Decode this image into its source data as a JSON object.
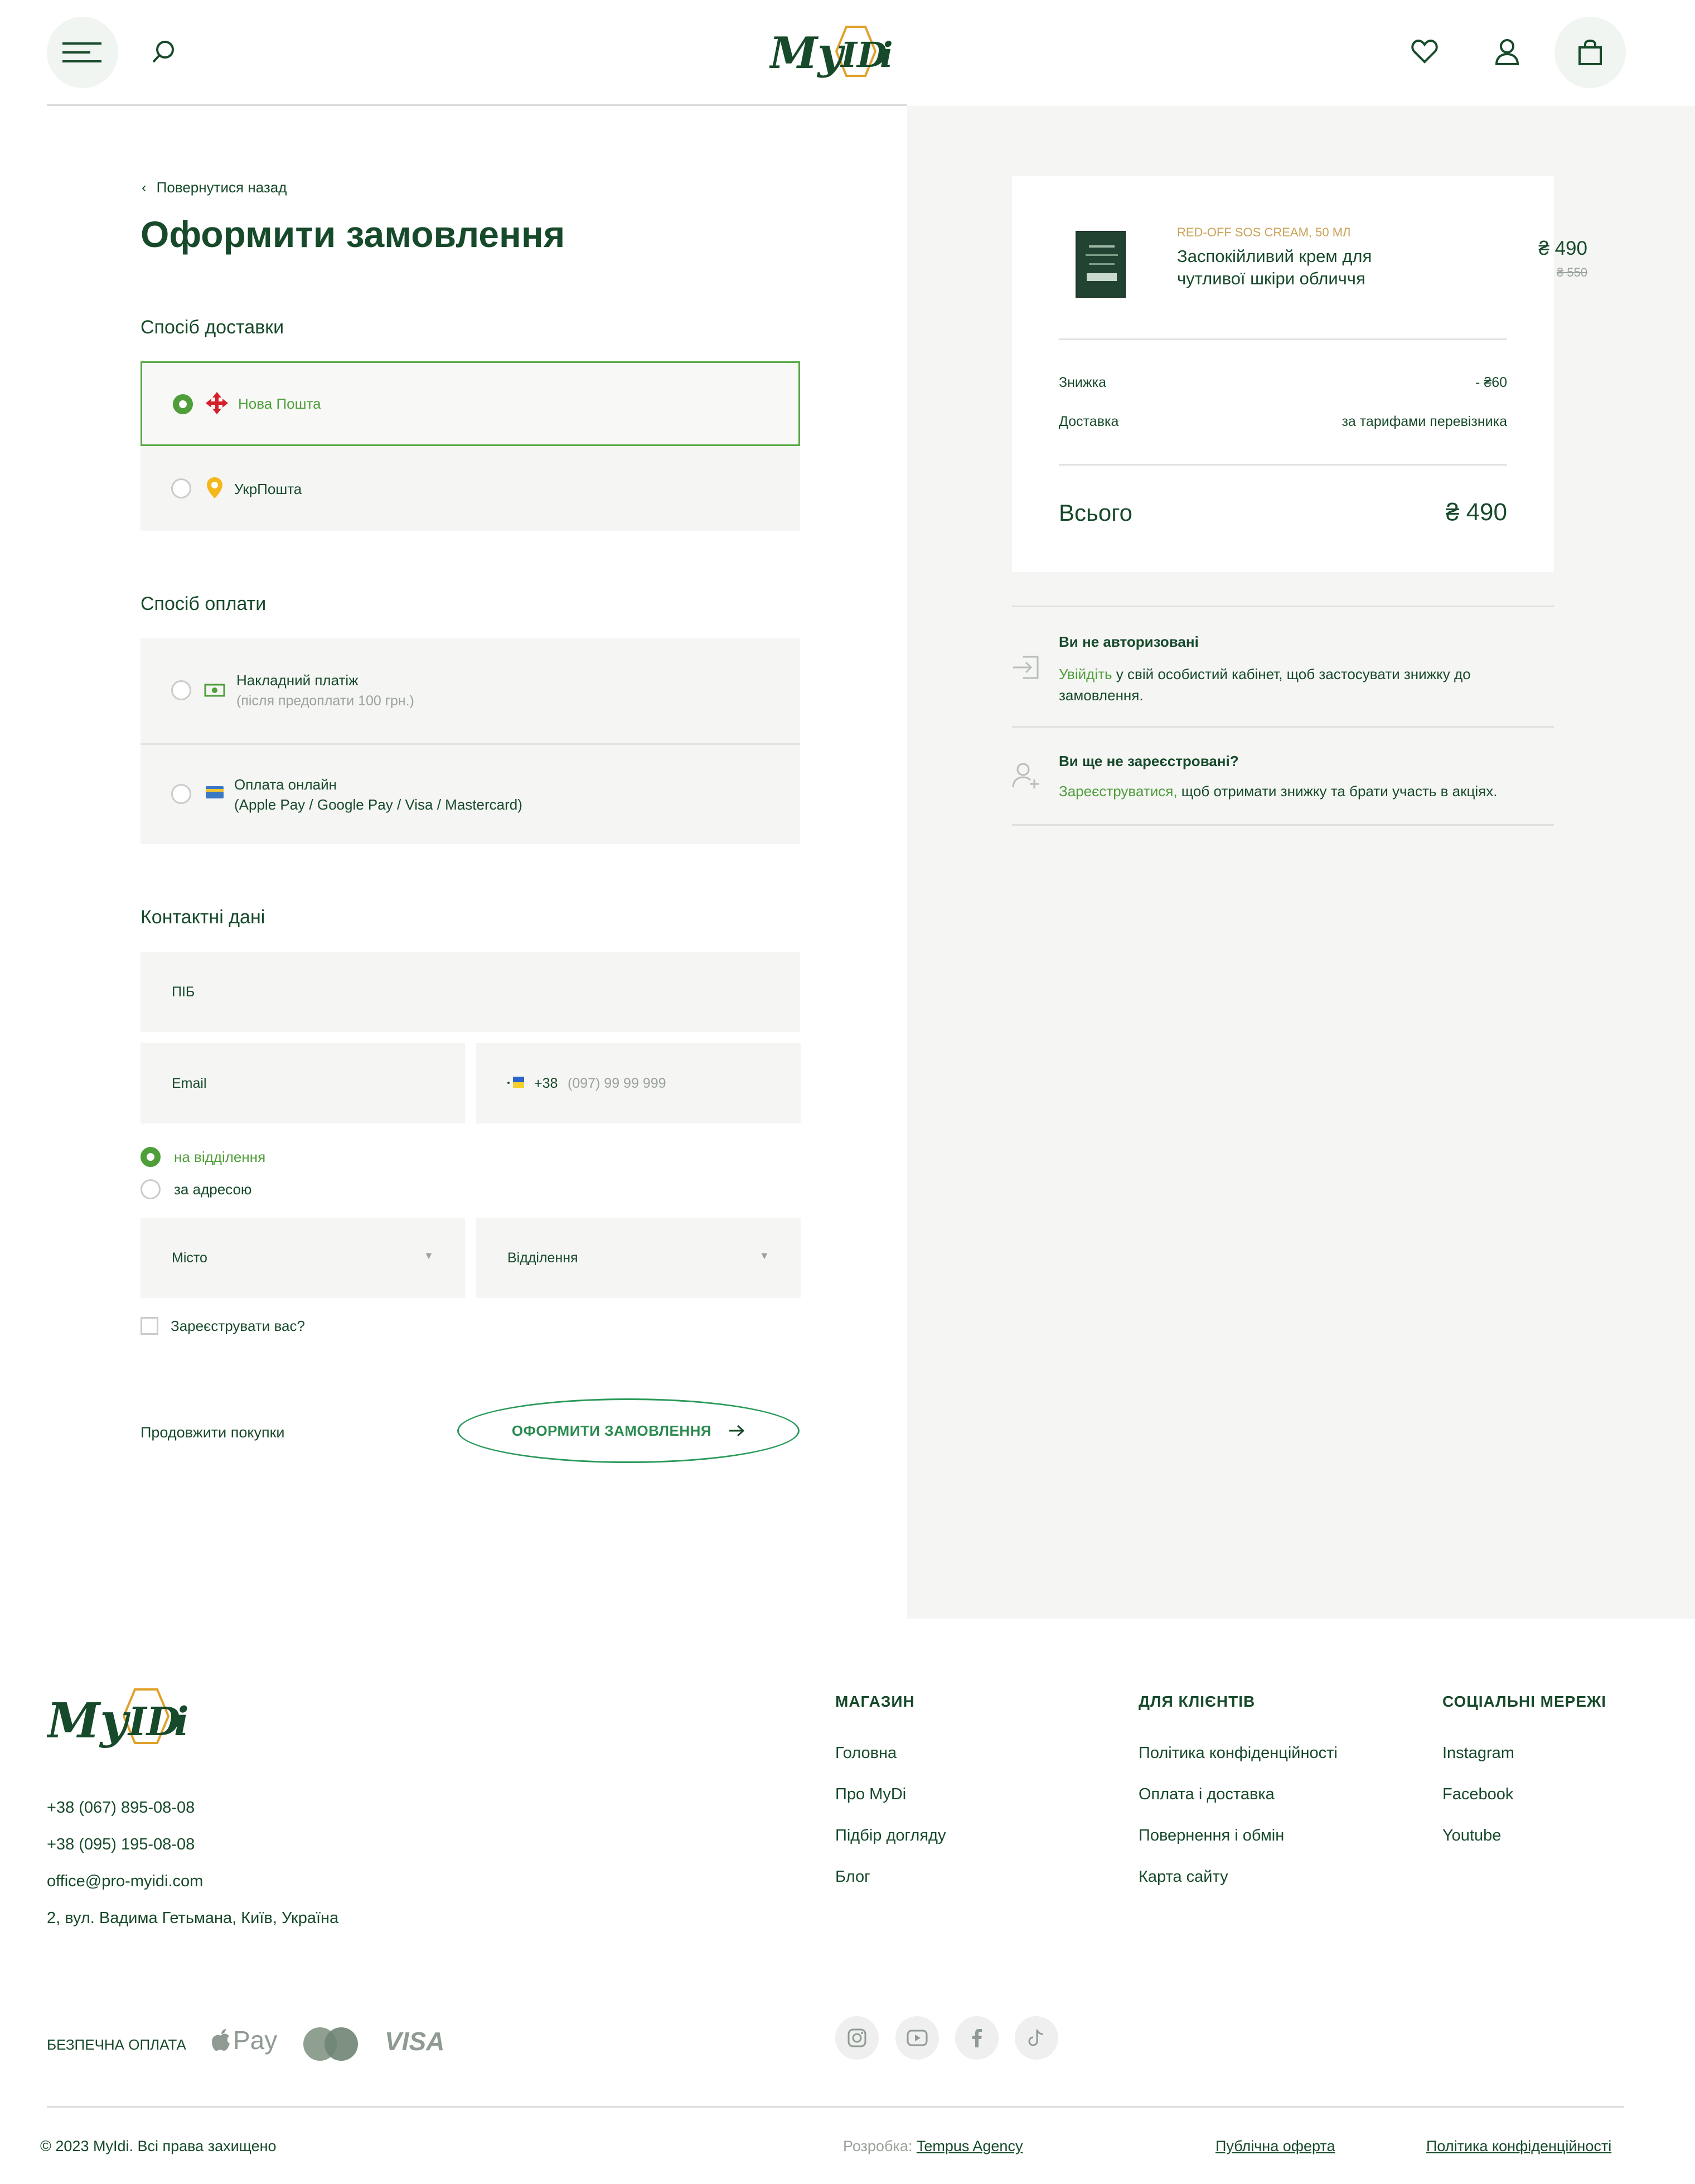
{
  "header": {
    "logo": "MyIDi",
    "menu_icon": "menu-icon",
    "search_icon": "search-icon",
    "wishlist_icon": "heart-icon",
    "account_icon": "user-icon",
    "cart_icon": "bag-icon"
  },
  "checkout": {
    "back_label": "Повернутися назад",
    "title": "Оформити замовлення",
    "delivery": {
      "title": "Спосіб доставки",
      "options": [
        {
          "label": "Нова Пошта",
          "selected": true
        },
        {
          "label": "УкрПошта",
          "selected": false
        }
      ]
    },
    "payment": {
      "title": "Спосіб оплати",
      "options": [
        {
          "label": "Накладний платіж",
          "note": "(після предоплати 100 грн.)",
          "selected": false
        },
        {
          "label": "Оплата онлайн",
          "note": "(Apple Pay / Google Pay / Visa / Mastercard)",
          "selected": false
        }
      ]
    },
    "contacts": {
      "title": "Контактні дані",
      "name_label": "ПІБ",
      "email_label": "Email",
      "phone_code": "+38",
      "phone_placeholder": "(097) 99 99 999",
      "delivery_mode": [
        {
          "label": "на відділення",
          "selected": true
        },
        {
          "label": "за адресою",
          "selected": false
        }
      ],
      "city_label": "Місто",
      "branch_label": "Відділення",
      "register_label": "Зареєструвати вас?"
    },
    "continue_label": "Продовжити покупки",
    "submit_label": "ОФОРМИТИ ЗАМОВЛЕННЯ"
  },
  "summary": {
    "product": {
      "brand": "RED-OFF SOS CREAM, 50 МЛ",
      "name_line1": "Заспокійливий крем для",
      "name_line2": "чутливої шкіри обличчя",
      "price": "₴ 490",
      "old_price": "₴ 550"
    },
    "discount_label": "Знижка",
    "discount_value": "- ₴60",
    "shipping_label": "Доставка",
    "shipping_value": "за тарифами перевізника",
    "total_label": "Всього",
    "total_value": "₴ 490",
    "notice1": {
      "title": "Ви не авторизовані",
      "link": "Увійдіть",
      "text1": " у свій особистий кабінет, щоб застосувати знижку до",
      "text2": "замовлення."
    },
    "notice2": {
      "title": "Ви ще не зареєстровані?",
      "link": "Зареєструватися,",
      "text": " щоб отримати знижку та брати участь в акціях."
    }
  },
  "footer": {
    "logo": "MyIDi",
    "phone1": "+38 (067) 895-08-08",
    "phone2": "+38 (095) 195-08-08",
    "email": "office@pro-myidi.com",
    "address": "2, вул. Вадима Гетьмана, Київ, Україна",
    "shop": {
      "title": "МАГАЗИН",
      "links": [
        "Головна",
        "Про MyDi",
        "Підбір догляду",
        "Блог"
      ]
    },
    "clients": {
      "title": "ДЛЯ КЛІЄНТІВ",
      "links": [
        "Політика конфіденційності",
        "Оплата і доставка",
        "Повернення і обмін",
        "Карта сайту"
      ]
    },
    "social": {
      "title": "СОЦІАЛЬНІ МЕРЕЖІ",
      "links": [
        "Instagram",
        "Facebook",
        "Youtube"
      ]
    },
    "secure_label": "БЕЗПЕЧНА ОПЛАТА",
    "apple_pay": "Pay",
    "visa": "VISA",
    "copyright": "© 2023 MyIdi. Всі права захищено",
    "dev_prefix": "Розробка: ",
    "dev_name": "Tempus Agency",
    "offer": "Публічна оферта",
    "privacy": "Політика конфіденційності"
  }
}
